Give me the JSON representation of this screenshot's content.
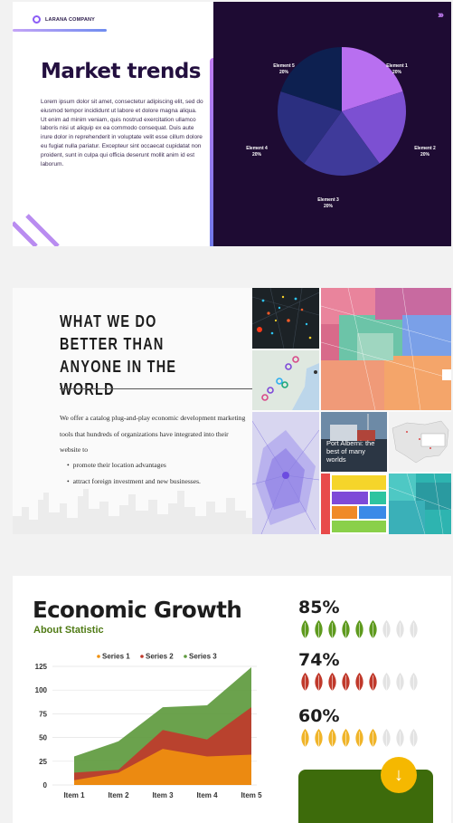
{
  "card1": {
    "company_name": "LARANA COMPANY",
    "title": "Market trends",
    "body": "Lorem ipsum dolor sit amet, consectetur adipiscing elit, sed do eiusmod tempor incididunt ut labore et dolore magna aliqua. Ut enim ad minim veniam, quis nostrud exercitation ullamco laboris nisi ut aliquip ex ea commodo consequat. Duis aute irure dolor in reprehenderit in voluptate velit esse cillum dolore eu fugiat nulla pariatur. Excepteur sint occaecat cupidatat non proident, sunt in culpa qui officia deserunt mollit anim id est laborum.",
    "nav_icon": "chevrons-right-icon",
    "accent_color": "#c27cf2"
  },
  "card2": {
    "title": "WHAT WE DO BETTER THAN ANYONE IN THE WORLD",
    "intro": "We offer a catalog plug-and-play economic development marketing tools that hundreds of organizations have integrated into their website to",
    "bullets": [
      "promote their location advantages",
      "attract foreign investment and new businesses."
    ],
    "tile_caption": "Port Alberni: the best of many worlds"
  },
  "card3": {
    "title": "Economic Growth",
    "subtitle": "About Statistic",
    "stats": [
      {
        "value": "85%",
        "filled": 6,
        "total": 9,
        "color": "#5e9a1e"
      },
      {
        "value": "74%",
        "filled": 6,
        "total": 9,
        "color": "#c0392b"
      },
      {
        "value": "60%",
        "filled": 6,
        "total": 9,
        "color": "#f0b429"
      }
    ],
    "down_icon": "arrow-down-icon",
    "box_color": "#3d6b0b"
  },
  "chart_data": [
    {
      "type": "pie",
      "categories": [
        "Element 1",
        "Element 2",
        "Element 3",
        "Element 4",
        "Element 5"
      ],
      "values": [
        20,
        20,
        20,
        20,
        20
      ],
      "labels": [
        "20%",
        "20%",
        "20%",
        "20%",
        "20%"
      ],
      "colors": [
        "#b86ff0",
        "#7c50d2",
        "#3f3a9a",
        "#2b2f80",
        "#0d2050"
      ]
    },
    {
      "type": "area",
      "categories": [
        "Item 1",
        "Item 2",
        "Item 3",
        "Item 4",
        "Item 5"
      ],
      "series": [
        {
          "name": "Series 1",
          "values": [
            5,
            13,
            38,
            30,
            32
          ],
          "color": "#f0900f"
        },
        {
          "name": "Series 2",
          "values": [
            13,
            16,
            58,
            48,
            82
          ],
          "color": "#c0392b"
        },
        {
          "name": "Series 3",
          "values": [
            30,
            46,
            82,
            84,
            124
          ],
          "color": "#5e9a3e"
        }
      ],
      "ylim": [
        0,
        125
      ],
      "yticks": [
        "0",
        "25",
        "50",
        "75",
        "100",
        "125"
      ],
      "legend": "top",
      "grid": true
    }
  ]
}
